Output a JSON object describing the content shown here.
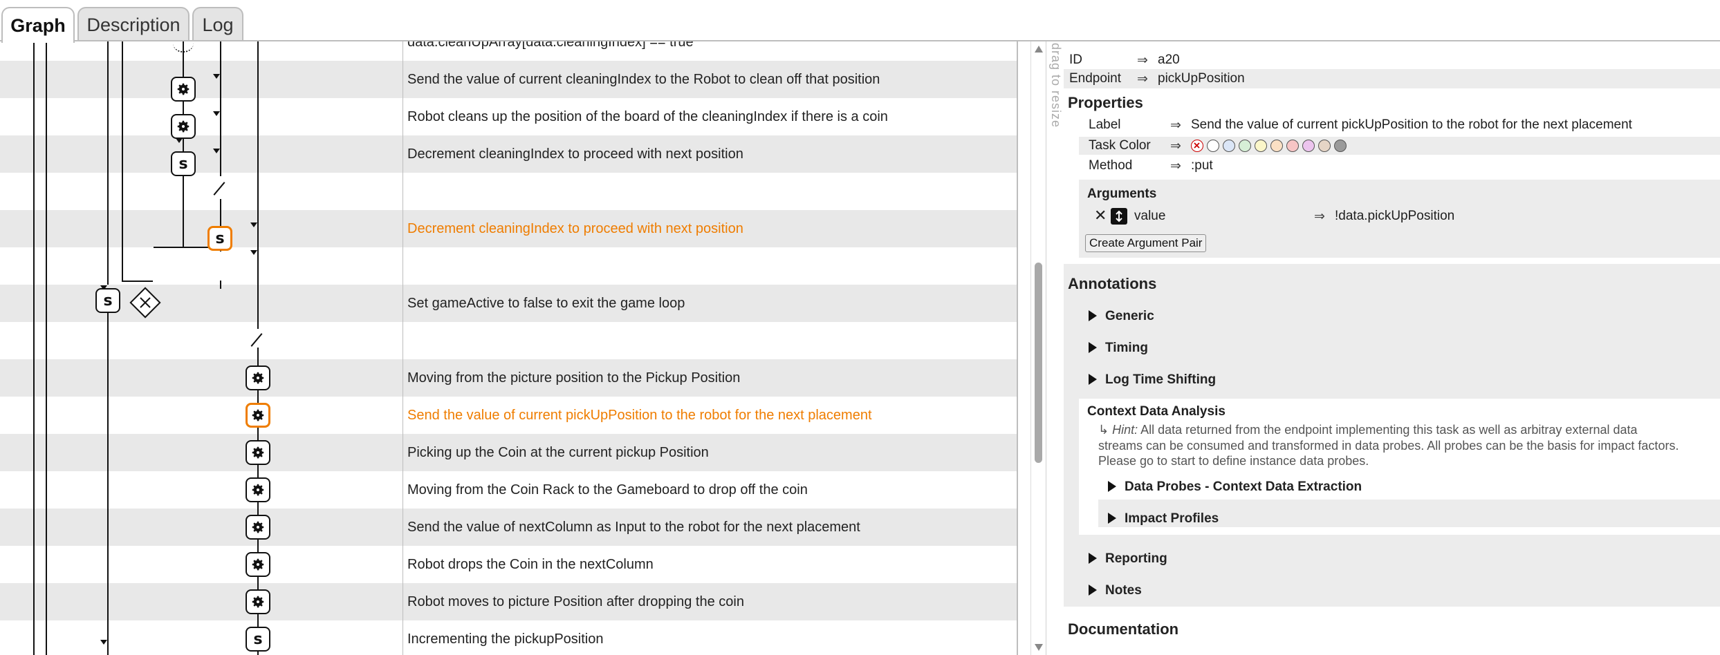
{
  "tabs": [
    "Graph",
    "Description",
    "Log"
  ],
  "active_tab": "Graph",
  "resize_handle_label": "drag to resize",
  "graph_rows": [
    {
      "label": "data.cleanUpArray[data.cleaningIndex] == true",
      "id": "",
      "shade": false,
      "highlight": false
    },
    {
      "label": "Send the value of current cleaningIndex to the Robot to clean off that position",
      "id": "a2",
      "shade": true,
      "highlight": false
    },
    {
      "label": "Robot cleans up the position of the board of the cleaningIndex if there is a coin",
      "id": "a2",
      "shade": false,
      "highlight": false
    },
    {
      "label": "Decrement cleaningIndex to proceed with next position",
      "id": "a2",
      "shade": true,
      "highlight": false
    },
    {
      "label": "",
      "id": "",
      "shade": false,
      "highlight": false
    },
    {
      "label": "Decrement cleaningIndex to proceed with next position",
      "id": "a2",
      "shade": true,
      "highlight": true
    },
    {
      "label": "",
      "id": "",
      "shade": false,
      "highlight": false
    },
    {
      "label": "Set gameActive to false to exit the game loop",
      "id": "a1",
      "shade": true,
      "highlight": false
    },
    {
      "label": "",
      "id": "",
      "shade": false,
      "highlight": false
    },
    {
      "label": "Moving from the picture position to the Pickup Position",
      "id": "a1",
      "shade": true,
      "highlight": false
    },
    {
      "label": "Send the value of current pickUpPosition to the robot for the next placement",
      "id": "a2",
      "shade": false,
      "highlight": true
    },
    {
      "label": "Picking up the Coin at the current pickup Position",
      "id": "a3",
      "shade": true,
      "highlight": false
    },
    {
      "label": "Moving from the Coin Rack to the Gameboard to drop off the coin",
      "id": "a6",
      "shade": false,
      "highlight": false
    },
    {
      "label": "Send the value of nextColumn as Input to the robot for the next placement",
      "id": "a1",
      "shade": true,
      "highlight": false
    },
    {
      "label": "Robot drops the Coin in the nextColumn",
      "id": "a7",
      "shade": false,
      "highlight": false
    },
    {
      "label": "Robot moves to picture Position after dropping the coin",
      "id": "a1",
      "shade": true,
      "highlight": false
    },
    {
      "label": "Incrementing the pickupPosition",
      "id": "a2",
      "shade": false,
      "highlight": false
    }
  ],
  "panel": {
    "id_label": "ID",
    "id_value": "a20",
    "endpoint_label": "Endpoint",
    "endpoint_value": "pickUpPosition",
    "properties_heading": "Properties",
    "label_key": "Label",
    "label_value": "Send the value of current pickUpPosition to the robot for the next placement",
    "task_color_key": "Task Color",
    "task_colors": [
      "#ffffff",
      "#dbe6f7",
      "#d6efd6",
      "#fbf6c9",
      "#fbe0c4",
      "#f7c5c5",
      "#ecc4ee",
      "#e6d5c6",
      "#9a9a9a"
    ],
    "method_key": "Method",
    "method_value": ":put",
    "arguments_heading": "Arguments",
    "argument_name": "value",
    "argument_value": "!data.pickUpPosition",
    "create_argument_pair": "Create Argument Pair",
    "annotations_heading": "Annotations",
    "annotation_sections": [
      "Generic",
      "Timing",
      "Log Time Shifting"
    ],
    "context_heading": "Context Data Analysis",
    "hint_prefix": "Hint:",
    "hint_line1": " All data returned from the endpoint implementing this task as well as arbitray external data",
    "hint_line2": "streams can be consumed and transformed in data probes. All probes can be the basis for impact factors.",
    "hint_line3": "Please go to start to define instance data probes.",
    "context_sections": [
      "Data Probes - Context Data Extraction",
      "Impact Profiles"
    ],
    "lower_sections": [
      "Reporting",
      "Notes"
    ],
    "documentation_heading": "Documentation"
  },
  "colors": {
    "highlight": "#ef7d00",
    "row_shade": "#e8e8e8",
    "panel_box": "#ececec"
  }
}
